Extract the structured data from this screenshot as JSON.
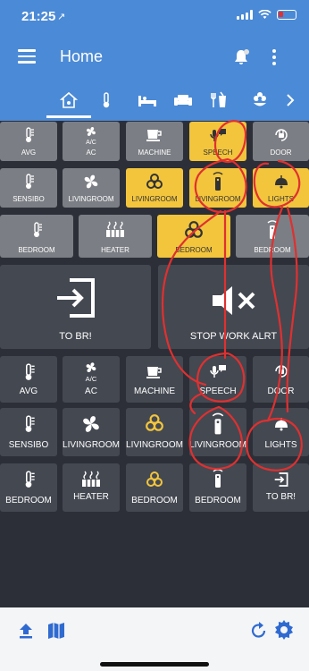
{
  "status": {
    "time": "21:25",
    "location_arrow": "↗"
  },
  "appbar": {
    "title": "Home"
  },
  "tabs": [
    "home-automation-icon",
    "thermometer-icon",
    "bed-icon",
    "sofa-icon",
    "kitchen-icon",
    "flower-icon",
    "chevron-right-icon"
  ],
  "small_tiles": {
    "r1": [
      "AVG",
      "AC",
      "MACHINE",
      "SPEECH",
      "DOOR"
    ],
    "r2": [
      "SENSIBO",
      "LIVINGROOM",
      "LIVINGROOM",
      "LIVINGROOM",
      "LIGHTS"
    ],
    "r3": [
      "BEDROOM",
      "HEATER",
      "BEDROOM",
      "BEDROOM"
    ]
  },
  "big_tiles": {
    "left": "TO BR!",
    "right": "STOP WORK ALRT"
  },
  "md_tiles": {
    "r1": [
      "AVG",
      "AC",
      "MACHINE",
      "SPEECH",
      "DOOR"
    ],
    "r2": [
      "SENSIBO",
      "LIVINGROOM",
      "LIVINGROOM",
      "LIVINGROOM",
      "LIGHTS"
    ],
    "r3": [
      "BEDROOM",
      "HEATER",
      "BEDROOM",
      "BEDROOM",
      "TO BR!"
    ]
  },
  "colors": {
    "header": "#4b8ad6",
    "active": "#f2c53d",
    "off": "#7b7e84",
    "annotation": "#e03030"
  }
}
